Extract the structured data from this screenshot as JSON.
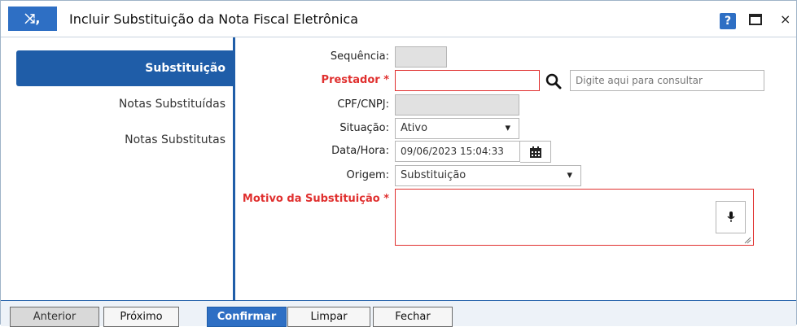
{
  "window": {
    "title": "Incluir Substituição da Nota Fiscal Eletrônica",
    "app_icon_glyph": "⤨,",
    "help_label": "?",
    "close_label": "×"
  },
  "sidebar": {
    "items": [
      {
        "label": "Substituição",
        "active": true
      },
      {
        "label": "Notas Substituídas",
        "active": false
      },
      {
        "label": "Notas Substitutas",
        "active": false
      }
    ]
  },
  "form": {
    "sequencia": {
      "label": "Sequência:",
      "value": ""
    },
    "prestador": {
      "label": "Prestador *",
      "value": "",
      "search_placeholder": "Digite aqui para consultar"
    },
    "cpf_cnpj": {
      "label": "CPF/CNPJ:",
      "value": ""
    },
    "situacao": {
      "label": "Situação:",
      "value": "Ativo"
    },
    "data_hora": {
      "label": "Data/Hora:",
      "value": "09/06/2023 15:04:33"
    },
    "origem": {
      "label": "Origem:",
      "value": "Substituição"
    },
    "motivo": {
      "label": "Motivo da Substituição *",
      "value": ""
    }
  },
  "footer": {
    "anterior": "Anterior",
    "proximo": "Próximo",
    "confirmar": "Confirmar",
    "limpar": "Limpar",
    "fechar": "Fechar"
  },
  "colors": {
    "accent": "#2e6fc4",
    "required": "#e0302f",
    "sidebar_active": "#1f5da8"
  }
}
